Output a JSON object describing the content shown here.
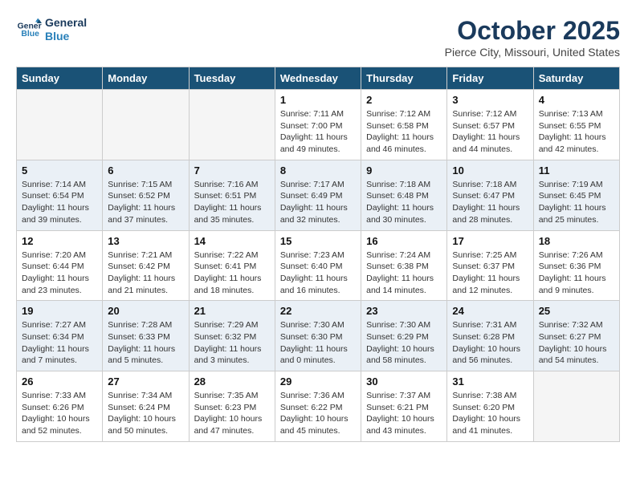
{
  "header": {
    "logo_line1": "General",
    "logo_line2": "Blue",
    "month": "October 2025",
    "location": "Pierce City, Missouri, United States"
  },
  "days_of_week": [
    "Sunday",
    "Monday",
    "Tuesday",
    "Wednesday",
    "Thursday",
    "Friday",
    "Saturday"
  ],
  "weeks": [
    [
      {
        "day": "",
        "empty": true
      },
      {
        "day": "",
        "empty": true
      },
      {
        "day": "",
        "empty": true
      },
      {
        "day": "1",
        "sunrise": "Sunrise: 7:11 AM",
        "sunset": "Sunset: 7:00 PM",
        "daylight": "Daylight: 11 hours and 49 minutes."
      },
      {
        "day": "2",
        "sunrise": "Sunrise: 7:12 AM",
        "sunset": "Sunset: 6:58 PM",
        "daylight": "Daylight: 11 hours and 46 minutes."
      },
      {
        "day": "3",
        "sunrise": "Sunrise: 7:12 AM",
        "sunset": "Sunset: 6:57 PM",
        "daylight": "Daylight: 11 hours and 44 minutes."
      },
      {
        "day": "4",
        "sunrise": "Sunrise: 7:13 AM",
        "sunset": "Sunset: 6:55 PM",
        "daylight": "Daylight: 11 hours and 42 minutes."
      }
    ],
    [
      {
        "day": "5",
        "sunrise": "Sunrise: 7:14 AM",
        "sunset": "Sunset: 6:54 PM",
        "daylight": "Daylight: 11 hours and 39 minutes."
      },
      {
        "day": "6",
        "sunrise": "Sunrise: 7:15 AM",
        "sunset": "Sunset: 6:52 PM",
        "daylight": "Daylight: 11 hours and 37 minutes."
      },
      {
        "day": "7",
        "sunrise": "Sunrise: 7:16 AM",
        "sunset": "Sunset: 6:51 PM",
        "daylight": "Daylight: 11 hours and 35 minutes."
      },
      {
        "day": "8",
        "sunrise": "Sunrise: 7:17 AM",
        "sunset": "Sunset: 6:49 PM",
        "daylight": "Daylight: 11 hours and 32 minutes."
      },
      {
        "day": "9",
        "sunrise": "Sunrise: 7:18 AM",
        "sunset": "Sunset: 6:48 PM",
        "daylight": "Daylight: 11 hours and 30 minutes."
      },
      {
        "day": "10",
        "sunrise": "Sunrise: 7:18 AM",
        "sunset": "Sunset: 6:47 PM",
        "daylight": "Daylight: 11 hours and 28 minutes."
      },
      {
        "day": "11",
        "sunrise": "Sunrise: 7:19 AM",
        "sunset": "Sunset: 6:45 PM",
        "daylight": "Daylight: 11 hours and 25 minutes."
      }
    ],
    [
      {
        "day": "12",
        "sunrise": "Sunrise: 7:20 AM",
        "sunset": "Sunset: 6:44 PM",
        "daylight": "Daylight: 11 hours and 23 minutes."
      },
      {
        "day": "13",
        "sunrise": "Sunrise: 7:21 AM",
        "sunset": "Sunset: 6:42 PM",
        "daylight": "Daylight: 11 hours and 21 minutes."
      },
      {
        "day": "14",
        "sunrise": "Sunrise: 7:22 AM",
        "sunset": "Sunset: 6:41 PM",
        "daylight": "Daylight: 11 hours and 18 minutes."
      },
      {
        "day": "15",
        "sunrise": "Sunrise: 7:23 AM",
        "sunset": "Sunset: 6:40 PM",
        "daylight": "Daylight: 11 hours and 16 minutes."
      },
      {
        "day": "16",
        "sunrise": "Sunrise: 7:24 AM",
        "sunset": "Sunset: 6:38 PM",
        "daylight": "Daylight: 11 hours and 14 minutes."
      },
      {
        "day": "17",
        "sunrise": "Sunrise: 7:25 AM",
        "sunset": "Sunset: 6:37 PM",
        "daylight": "Daylight: 11 hours and 12 minutes."
      },
      {
        "day": "18",
        "sunrise": "Sunrise: 7:26 AM",
        "sunset": "Sunset: 6:36 PM",
        "daylight": "Daylight: 11 hours and 9 minutes."
      }
    ],
    [
      {
        "day": "19",
        "sunrise": "Sunrise: 7:27 AM",
        "sunset": "Sunset: 6:34 PM",
        "daylight": "Daylight: 11 hours and 7 minutes."
      },
      {
        "day": "20",
        "sunrise": "Sunrise: 7:28 AM",
        "sunset": "Sunset: 6:33 PM",
        "daylight": "Daylight: 11 hours and 5 minutes."
      },
      {
        "day": "21",
        "sunrise": "Sunrise: 7:29 AM",
        "sunset": "Sunset: 6:32 PM",
        "daylight": "Daylight: 11 hours and 3 minutes."
      },
      {
        "day": "22",
        "sunrise": "Sunrise: 7:30 AM",
        "sunset": "Sunset: 6:30 PM",
        "daylight": "Daylight: 11 hours and 0 minutes."
      },
      {
        "day": "23",
        "sunrise": "Sunrise: 7:30 AM",
        "sunset": "Sunset: 6:29 PM",
        "daylight": "Daylight: 10 hours and 58 minutes."
      },
      {
        "day": "24",
        "sunrise": "Sunrise: 7:31 AM",
        "sunset": "Sunset: 6:28 PM",
        "daylight": "Daylight: 10 hours and 56 minutes."
      },
      {
        "day": "25",
        "sunrise": "Sunrise: 7:32 AM",
        "sunset": "Sunset: 6:27 PM",
        "daylight": "Daylight: 10 hours and 54 minutes."
      }
    ],
    [
      {
        "day": "26",
        "sunrise": "Sunrise: 7:33 AM",
        "sunset": "Sunset: 6:26 PM",
        "daylight": "Daylight: 10 hours and 52 minutes."
      },
      {
        "day": "27",
        "sunrise": "Sunrise: 7:34 AM",
        "sunset": "Sunset: 6:24 PM",
        "daylight": "Daylight: 10 hours and 50 minutes."
      },
      {
        "day": "28",
        "sunrise": "Sunrise: 7:35 AM",
        "sunset": "Sunset: 6:23 PM",
        "daylight": "Daylight: 10 hours and 47 minutes."
      },
      {
        "day": "29",
        "sunrise": "Sunrise: 7:36 AM",
        "sunset": "Sunset: 6:22 PM",
        "daylight": "Daylight: 10 hours and 45 minutes."
      },
      {
        "day": "30",
        "sunrise": "Sunrise: 7:37 AM",
        "sunset": "Sunset: 6:21 PM",
        "daylight": "Daylight: 10 hours and 43 minutes."
      },
      {
        "day": "31",
        "sunrise": "Sunrise: 7:38 AM",
        "sunset": "Sunset: 6:20 PM",
        "daylight": "Daylight: 10 hours and 41 minutes."
      },
      {
        "day": "",
        "empty": true
      }
    ]
  ]
}
